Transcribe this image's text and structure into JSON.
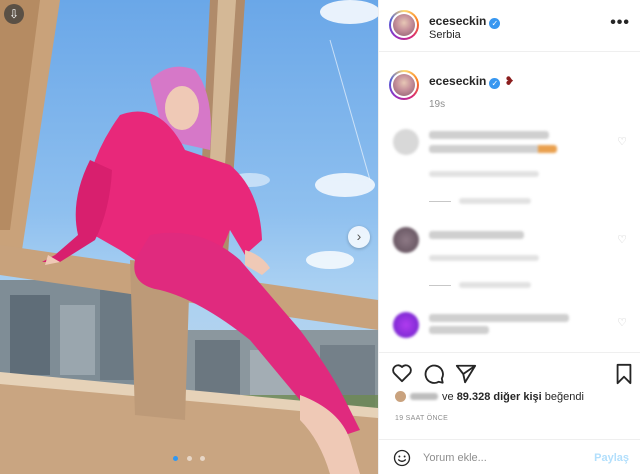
{
  "post": {
    "username": "eceseckin",
    "location": "Serbia",
    "more_label": "•••",
    "caption_emoji": "❥",
    "caption_time": "19s",
    "verified_mark": "✓"
  },
  "photo": {
    "download_icon": "⇩",
    "next_icon": "›",
    "dots": 3,
    "active_dot": 0
  },
  "icons": {
    "like": "heart-icon",
    "comment": "comment-bubble-icon",
    "share": "paper-plane-icon",
    "save": "bookmark-icon",
    "emoji": "smiley-icon",
    "comment_like": "♡"
  },
  "likes": {
    "prefix_blurred": true,
    "connector": "ve",
    "count": "89.328",
    "suffix": "diğer kişi",
    "verb": "beğendi"
  },
  "timeago": "19 SAAT ÖNCE",
  "comment_box": {
    "placeholder": "Yorum ekle...",
    "post_label": "Paylaş"
  },
  "colors": {
    "accent": "#3897f0",
    "post_disabled": "#b2dffc",
    "border": "#efefef",
    "outfit_pink": "#e8287a"
  }
}
